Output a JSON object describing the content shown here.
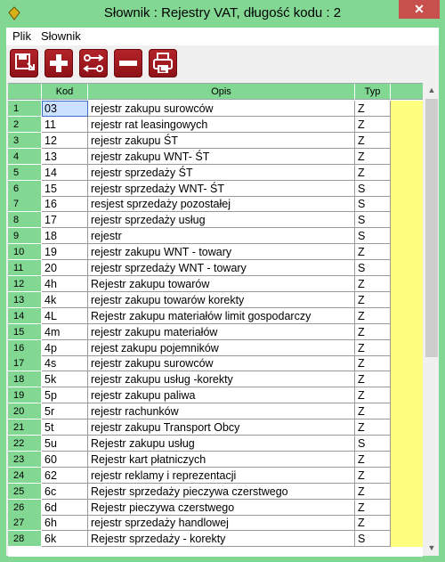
{
  "window": {
    "title": "Słownik : Rejestry VAT,  długość kodu : 2",
    "close_glyph": "✕"
  },
  "menu": [
    "Plik",
    "Słownik"
  ],
  "toolbar": [
    {
      "name": "save-icon"
    },
    {
      "name": "add-icon"
    },
    {
      "name": "swap-icon"
    },
    {
      "name": "remove-icon"
    },
    {
      "name": "print-icon"
    }
  ],
  "columns": {
    "kod": "Kod",
    "opis": "Opis",
    "typ": "Typ"
  },
  "rows": [
    {
      "n": "1",
      "kod": "03",
      "opis": "rejestr zakupu surowców",
      "typ": "Z"
    },
    {
      "n": "2",
      "kod": "11",
      "opis": "rejestr rat leasingowych",
      "typ": "Z"
    },
    {
      "n": "3",
      "kod": "12",
      "opis": "rejestr zakupu  ŚT",
      "typ": "Z"
    },
    {
      "n": "4",
      "kod": "13",
      "opis": "rejestr zakupu WNT- ŚT",
      "typ": "Z"
    },
    {
      "n": "5",
      "kod": "14",
      "opis": "rejestr sprzedaży ŚT",
      "typ": "Z"
    },
    {
      "n": "6",
      "kod": "15",
      "opis": "rejestr sprzedaży WNT- ŚT",
      "typ": "S"
    },
    {
      "n": "7",
      "kod": "16",
      "opis": "resjest sprzedaży pozostałej",
      "typ": "S"
    },
    {
      "n": "8",
      "kod": "17",
      "opis": "rejestr sprzedaży usług",
      "typ": "S"
    },
    {
      "n": "9",
      "kod": "18",
      "opis": "rejestr",
      "typ": "S"
    },
    {
      "n": "10",
      "kod": "19",
      "opis": "rejestr zakupu  WNT -  towary",
      "typ": "Z"
    },
    {
      "n": "11",
      "kod": "20",
      "opis": "rejestr sprzedaży  WNT -  towary",
      "typ": "S"
    },
    {
      "n": "12",
      "kod": "4h",
      "opis": "Rejestr zakupu towarów",
      "typ": "Z"
    },
    {
      "n": "13",
      "kod": "4k",
      "opis": "rejestr zakupu towarów  korekty",
      "typ": "Z"
    },
    {
      "n": "14",
      "kod": "4L",
      "opis": "Rejestr zakupu materiałów limit gospodarczy",
      "typ": "Z"
    },
    {
      "n": "15",
      "kod": "4m",
      "opis": "rejestr zakupu materiałów",
      "typ": "Z"
    },
    {
      "n": "16",
      "kod": "4p",
      "opis": "rejest zakupu pojemników",
      "typ": "Z"
    },
    {
      "n": "17",
      "kod": "4s",
      "opis": "rejestr zakupu surowców",
      "typ": "Z"
    },
    {
      "n": "18",
      "kod": "5k",
      "opis": "rejestr zakupu usług -korekty",
      "typ": "Z"
    },
    {
      "n": "19",
      "kod": "5p",
      "opis": "rejestr zakupu paliwa",
      "typ": "Z"
    },
    {
      "n": "20",
      "kod": "5r",
      "opis": "rejestr rachunków",
      "typ": "Z"
    },
    {
      "n": "21",
      "kod": "5t",
      "opis": "rejestr zakupu Transport Obcy",
      "typ": "Z"
    },
    {
      "n": "22",
      "kod": "5u",
      "opis": "Rejestr zakupu usług",
      "typ": "S"
    },
    {
      "n": "23",
      "kod": "60",
      "opis": "Rejestr kart płatniczych",
      "typ": "Z"
    },
    {
      "n": "24",
      "kod": "62",
      "opis": "rejestr reklamy i reprezentacji",
      "typ": "Z"
    },
    {
      "n": "25",
      "kod": "6c",
      "opis": "Rejestr sprzedaży pieczywa czerstwego",
      "typ": "Z"
    },
    {
      "n": "26",
      "kod": "6d",
      "opis": "Rejestr pieczywa czerstwego",
      "typ": "Z"
    },
    {
      "n": "27",
      "kod": "6h",
      "opis": "rejestr sprzedaży handlowej",
      "typ": "Z"
    },
    {
      "n": "28",
      "kod": "6k",
      "opis": "Rejestr sprzedaży - korekty",
      "typ": "S"
    }
  ],
  "colors": {
    "accent": "#82d893",
    "button": "#9e1a20",
    "yellow": "#ffff7f"
  }
}
